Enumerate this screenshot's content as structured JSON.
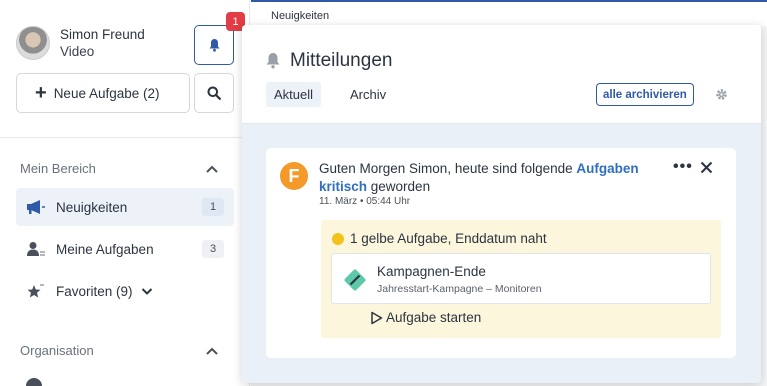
{
  "user": {
    "name": "Simon Freund",
    "role": "Video"
  },
  "notifications_badge": "1",
  "sidebar": {
    "new_task_label": "Neue Aufgabe (2)",
    "section_mine": "Mein Bereich",
    "items": [
      {
        "label": "Neuigkeiten",
        "count": "1",
        "icon": "megaphone-icon"
      },
      {
        "label": "Meine Aufgaben",
        "count": "3",
        "icon": "user-icon"
      },
      {
        "label": "Favoriten (9)",
        "icon": "star-icon"
      }
    ],
    "section_org": "Organisation"
  },
  "breadcrumb": "Neuigkeiten",
  "panel": {
    "title": "Mitteilungen",
    "tabs": [
      {
        "label": "Aktuell",
        "active": true
      },
      {
        "label": "Archiv",
        "active": false
      }
    ],
    "archive_all": "alle archivieren"
  },
  "notification": {
    "sender_initial": "F",
    "text_before": "Guten Morgen Simon, heute sind folgende ",
    "text_highlight": "Aufgaben kritisch",
    "text_after": " geworden",
    "time": "11. März • 05:44 Uhr",
    "group_text": "1 gelbe Aufgabe, Enddatum naht",
    "task_title": "Kampagnen-Ende",
    "task_subtitle": "Jahresstart-Kampagne – Monitoren",
    "start_label": "Aufgabe starten"
  },
  "colors": {
    "accent": "#2f5aa8",
    "badge": "#e23c44",
    "sender_logo": "#f39a2b",
    "yellow_status": "#f2c21b",
    "task_icon": "#5ccaa8"
  }
}
